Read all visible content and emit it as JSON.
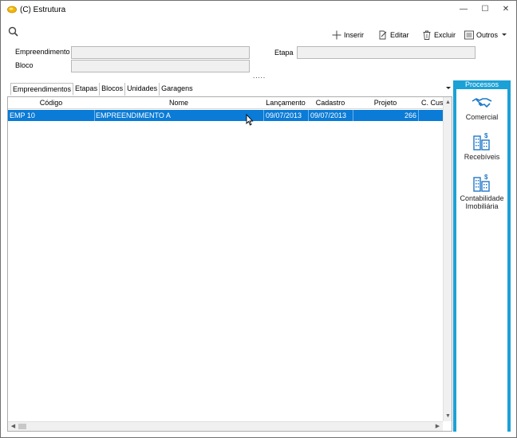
{
  "window": {
    "title": "(C) Estrutura",
    "controls": {
      "minimize": "—",
      "maximize": "☐",
      "close": "✕"
    }
  },
  "toolbar": {
    "inserir": "Inserir",
    "editar": "Editar",
    "excluir": "Excluir",
    "outros": "Outros"
  },
  "form": {
    "empreendimento_label": "Empreendimento",
    "empreendimento_value": "",
    "bloco_label": "Bloco",
    "bloco_value": "",
    "etapa_label": "Etapa",
    "etapa_value": "",
    "more": "....."
  },
  "tabs": [
    "Empreendimentos",
    "Etapas",
    "Blocos",
    "Unidades",
    "Garagens"
  ],
  "grid": {
    "columns": [
      "Código",
      "Nome",
      "Lançamento",
      "Cadastro",
      "Projeto",
      "C. Cust"
    ],
    "rows": [
      {
        "codigo": "EMP 10",
        "nome": "EMPREENDIMENTO A",
        "lancamento": "09/07/2013",
        "cadastro": "09/07/2013",
        "projeto": "266",
        "ccusto": ""
      }
    ]
  },
  "side_panel": {
    "header": "Processos",
    "items": [
      {
        "label": "Comercial",
        "icon": "handshake-icon"
      },
      {
        "label": "Recebíveis",
        "icon": "buildings-dollar-icon"
      },
      {
        "label_line1": "Contabilidade",
        "label_line2": "Imobiliária",
        "icon": "buildings-dollar-icon"
      }
    ]
  },
  "colors": {
    "accent": "#1ba1d6",
    "selection": "#0a7bd6",
    "field_bg": "#f0f0f0"
  }
}
